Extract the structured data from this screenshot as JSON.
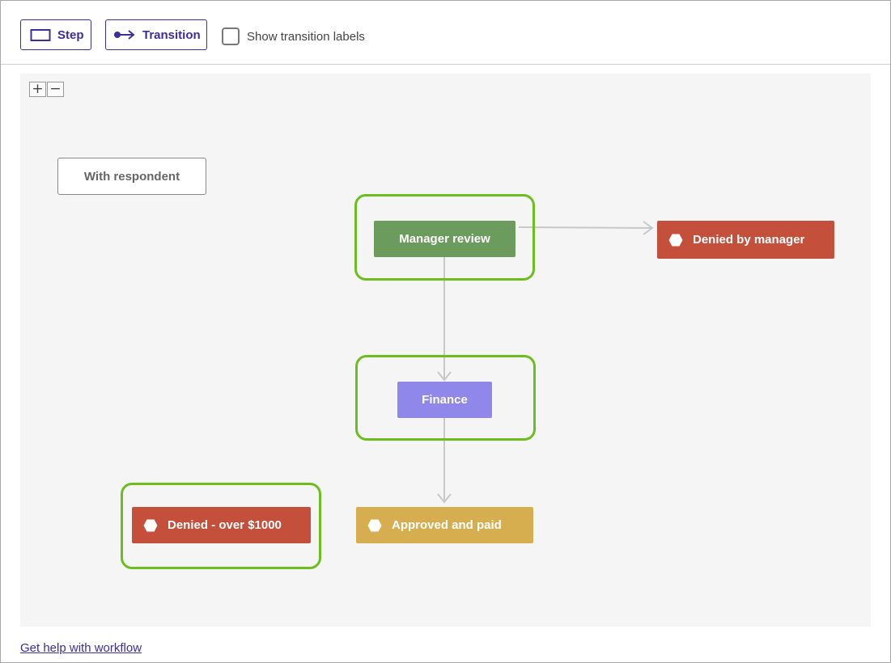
{
  "toolbar": {
    "step_label": "Step",
    "transition_label": "Transition",
    "show_labels_text": "Show transition labels",
    "show_labels_checked": false
  },
  "zoom": {
    "in_label": "+",
    "out_label": "−"
  },
  "nodes": {
    "with_respondent": "With respondent",
    "manager_review": "Manager review",
    "denied_by_manager": "Denied by manager",
    "finance": "Finance",
    "denied_over": "Denied - over $1000",
    "approved_paid": "Approved and paid"
  },
  "transitions": [
    {
      "from": "Manager review",
      "to": "Denied by manager"
    },
    {
      "from": "Manager review",
      "to": "Finance"
    },
    {
      "from": "Finance",
      "to": "Approved and paid"
    }
  ],
  "highlighted_nodes": [
    "Manager review",
    "Finance",
    "Denied - over $1000"
  ],
  "colors": {
    "accent": "#3b2f9b",
    "manager_review": "#6c9b5e",
    "denied": "#c4503b",
    "finance": "#8f87ea",
    "approved": "#d6ae50",
    "highlight": "#6cbe1c",
    "edge": "#c8c8c8"
  },
  "footer": {
    "help_link": "Get help with workflow"
  }
}
